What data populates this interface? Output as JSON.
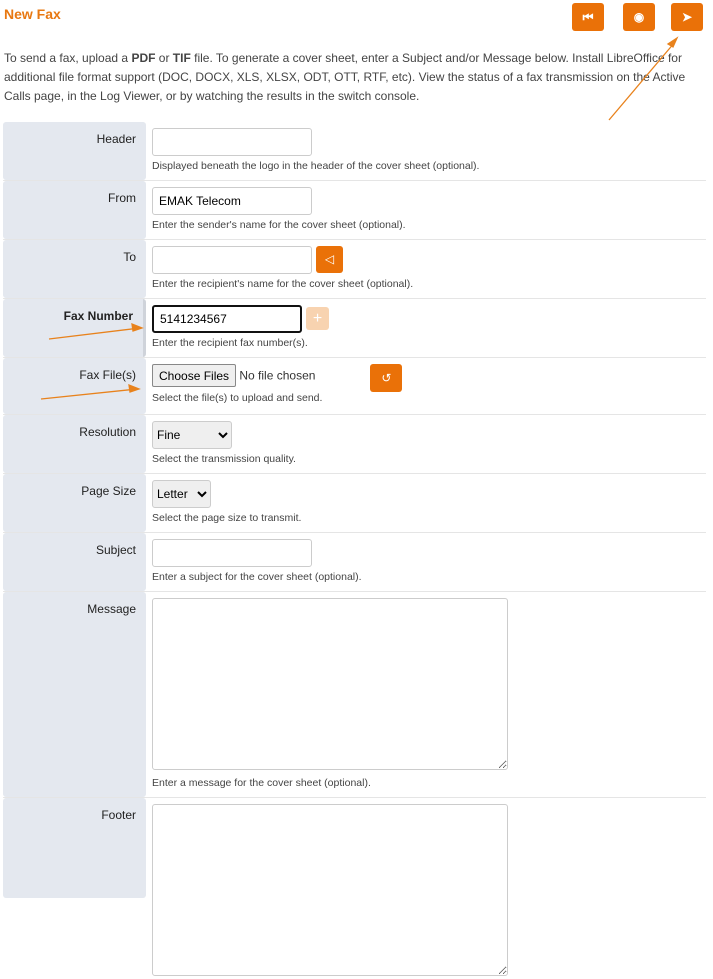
{
  "title": "New Fax",
  "description_parts": [
    "To send a fax, upload a ",
    "PDF",
    " or ",
    "TIF",
    " file. To generate a cover sheet, enter a Subject and/or Message below. Install LibreOffice for additional file format support (DOC, DOCX, XLS, XLSX, ODT, OTT, RTF, etc). View the status of a fax transmission on the Active Calls page, in the Log Viewer, or by watching the results in the switch console."
  ],
  "toolbar": {
    "back_icon": "skip-back-icon",
    "preview_icon": "eye-icon",
    "send_icon": "paper-plane-icon"
  },
  "fields": {
    "header": {
      "label": "Header",
      "value": "",
      "help": "Displayed beneath the logo in the header of the cover sheet (optional)."
    },
    "from": {
      "label": "From",
      "value": "EMAK Telecom",
      "help": "Enter the sender's name for the cover sheet (optional)."
    },
    "to": {
      "label": "To",
      "value": "",
      "help": "Enter the recipient's name for the cover sheet (optional)."
    },
    "fax_number": {
      "label": "Fax Number",
      "value": "5141234567",
      "help": "Enter the recipient fax number(s)."
    },
    "fax_files": {
      "label": "Fax File(s)",
      "button": "Choose Files",
      "status": "No file chosen",
      "help": "Select the file(s) to upload and send."
    },
    "resolution": {
      "label": "Resolution",
      "value": "Fine",
      "help": "Select the transmission quality."
    },
    "page_size": {
      "label": "Page Size",
      "value": "Letter",
      "help": "Select the page size to transmit."
    },
    "subject": {
      "label": "Subject",
      "value": "",
      "help": "Enter a subject for the cover sheet (optional)."
    },
    "message": {
      "label": "Message",
      "help": "Enter a message for the cover sheet (optional)."
    },
    "footer": {
      "label": "Footer"
    }
  },
  "colors": {
    "accent": "#ea7108",
    "label_bg": "#e4e8ef"
  }
}
